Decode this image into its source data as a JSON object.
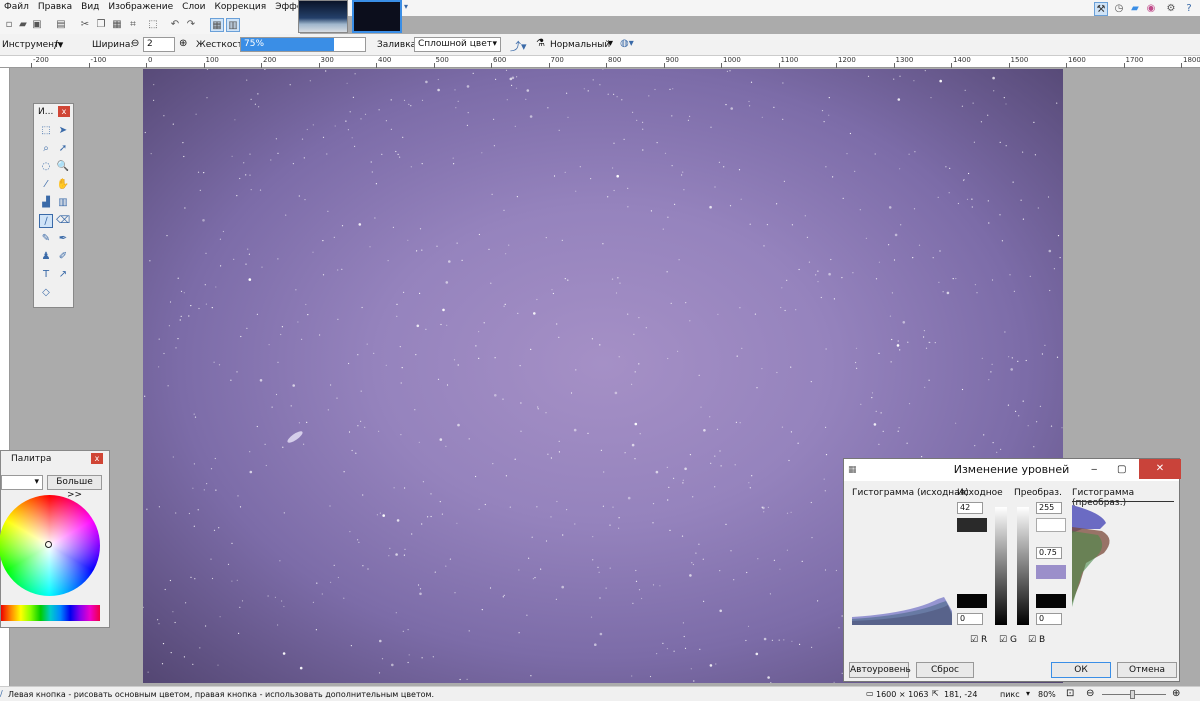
{
  "menu": [
    "Файл",
    "Правка",
    "Вид",
    "Изображение",
    "Слои",
    "Коррекция",
    "Эффекты"
  ],
  "toolbar": {
    "tool_label": "Инструмент:",
    "width_label": "Ширина:",
    "width_value": "2",
    "hardness_label": "Жесткость:",
    "hardness_value": "75%",
    "hardness_fraction": 0.75,
    "fill_label": "Заливка:",
    "fill_value": "Сплошной цвет",
    "blend_value": "Нормальный"
  },
  "ruler": {
    "labels": [
      "-200",
      "-100",
      "0",
      "100",
      "200",
      "300",
      "400",
      "500",
      "600",
      "700",
      "800",
      "900",
      "1000",
      "1100",
      "1200",
      "1300",
      "1400",
      "1500",
      "1600",
      "1700",
      "1800"
    ]
  },
  "tools_window": {
    "title": "И..."
  },
  "palette_window": {
    "title": "Палитра",
    "more_button": "Больше >>"
  },
  "levels_window": {
    "title": "Изменение уровней",
    "hist_in_label": "Гистограмма (исходная)",
    "input_label": "Исходное",
    "output_label": "Преобраз.",
    "hist_out_label": "Гистограмма (преобраз.)",
    "input_high": "42",
    "input_low": "0",
    "output_high": "255",
    "output_gamma": "0.75",
    "output_low": "0",
    "check_r": "R",
    "check_g": "G",
    "check_b": "B",
    "auto_button": "Автоуровень",
    "reset_button": "Сброс",
    "ok_button": "ОК",
    "cancel_button": "Отмена"
  },
  "status": {
    "hint": "Левая кнопка - рисовать основным цветом, правая кнопка - использовать дополнительным цветом.",
    "size": "1600 × 1063",
    "coords": "181, -24",
    "units": "пикс",
    "zoom": "80%"
  },
  "colors": {
    "canvas_center": "#a590c6",
    "canvas_edge": "#534672",
    "accent": "#3a8ee6",
    "close": "#d04535"
  }
}
